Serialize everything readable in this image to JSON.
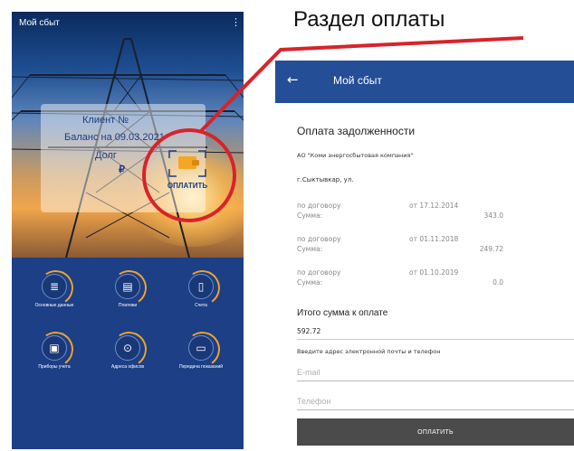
{
  "colors": {
    "header_blue": "#244e96",
    "bottom_blue": "#1c3f86",
    "accent_orange": "#f0a22a",
    "highlight_red": "#d8232a",
    "pay_button": "#4b4b4b"
  },
  "caption": "Раздел оплаты",
  "home_screen": {
    "title": "Мой сбыт",
    "menu_icon": "kebab-menu-icon",
    "card": {
      "client": "Клиент №",
      "balance": "Баланс на 09.03.2021",
      "debt": "Долг",
      "currency": "₽",
      "pay_label": "ОПЛАТИТЬ",
      "pay_icon": "wallet-icon"
    },
    "grid": [
      {
        "label": "Основные данные",
        "icon": "document-icon",
        "symbol": "≣"
      },
      {
        "label": "Платежи",
        "icon": "payments-icon",
        "symbol": "▤"
      },
      {
        "label": "Счета",
        "icon": "bills-icon",
        "symbol": "▯"
      },
      {
        "label": "Приборы учета",
        "icon": "meter-icon",
        "symbol": "▣"
      },
      {
        "label": "Адреса офисов",
        "icon": "location-pin-icon",
        "symbol": "⊙"
      },
      {
        "label": "Передача показаний",
        "icon": "readings-icon",
        "symbol": "▭"
      }
    ]
  },
  "payment_screen": {
    "back_icon": "back-arrow-icon",
    "back_symbol": "←",
    "title": "Мой сбыт",
    "heading": "Оплата задолженности",
    "company": "АО \"Коми энергосбытовая компания\"",
    "address": "г.Сыктывкар, ул.",
    "contracts": [
      {
        "label": "по договору",
        "date": "от 17.12.2014",
        "sum_label": "Сумма:",
        "sum": "343.0"
      },
      {
        "label": "по договору",
        "date": "от 01.11.2018",
        "sum_label": "Сумма:",
        "sum": "249.72"
      },
      {
        "label": "по договору",
        "date": "от 01.10.2019",
        "sum_label": "Сумма:",
        "sum": "0.0"
      }
    ],
    "total_label": "Итого сумма к оплате",
    "total_value": "592.72",
    "contact_prompt": "Введите адрес электронной почты и телефон",
    "email_placeholder": "E-mail",
    "phone_placeholder": "Телефон",
    "pay_button": "ОПЛАТИТЬ"
  }
}
